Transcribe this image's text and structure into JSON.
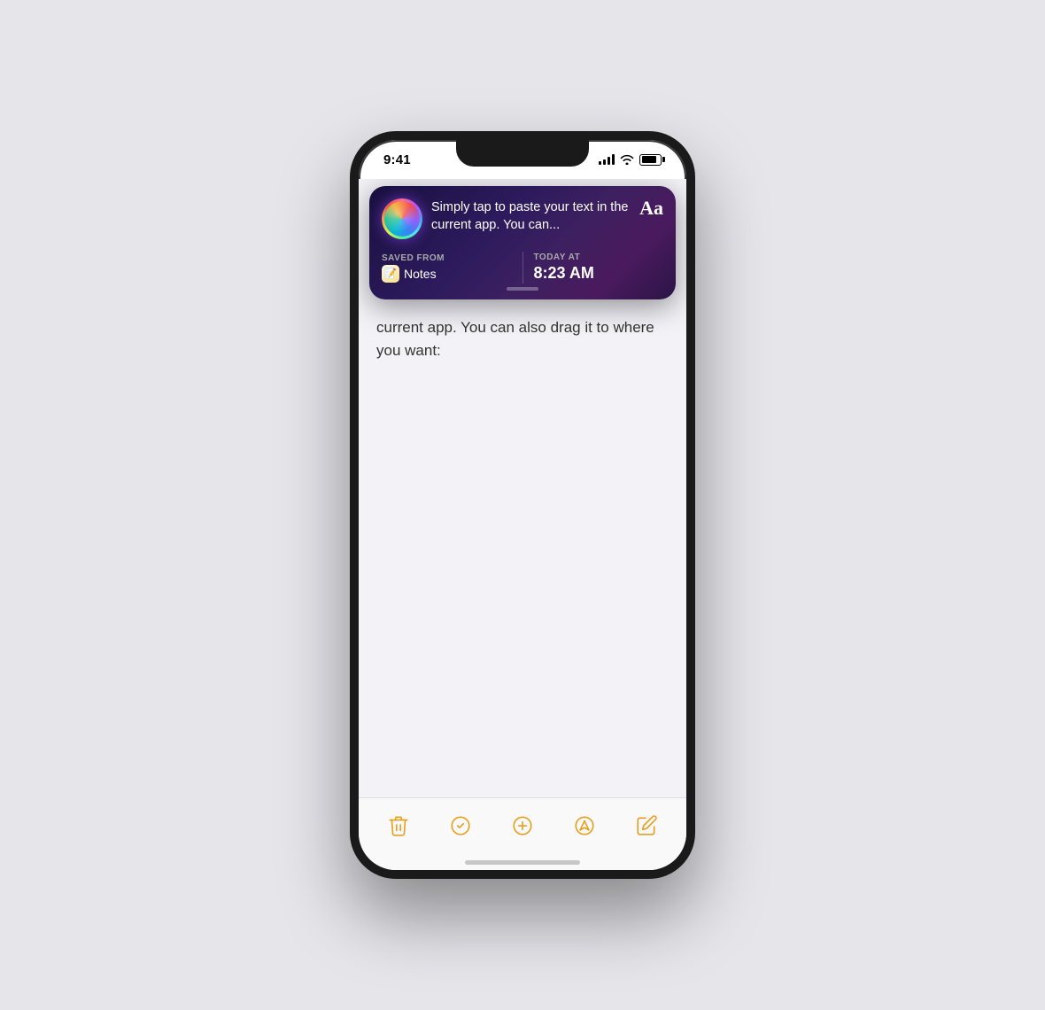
{
  "statusBar": {
    "time": "9:41",
    "signalBars": [
      4,
      6,
      8,
      10,
      12
    ],
    "batteryLevel": 80
  },
  "siriBanner": {
    "mainText": "Simply tap to paste your text in the current app. You can...",
    "aaButtonLabel": "Aa",
    "savedFromLabel": "SAVED FROM",
    "appName": "Notes",
    "todayAtLabel": "TODAY AT",
    "time": "8:23 AM",
    "handleVisible": true
  },
  "notesContent": {
    "text": "current app. You can also drag it to where you want:"
  },
  "toolbar": {
    "deleteLabel": "delete",
    "checkLabel": "check",
    "addLabel": "add",
    "shareLabel": "share",
    "composeLabel": "compose"
  }
}
